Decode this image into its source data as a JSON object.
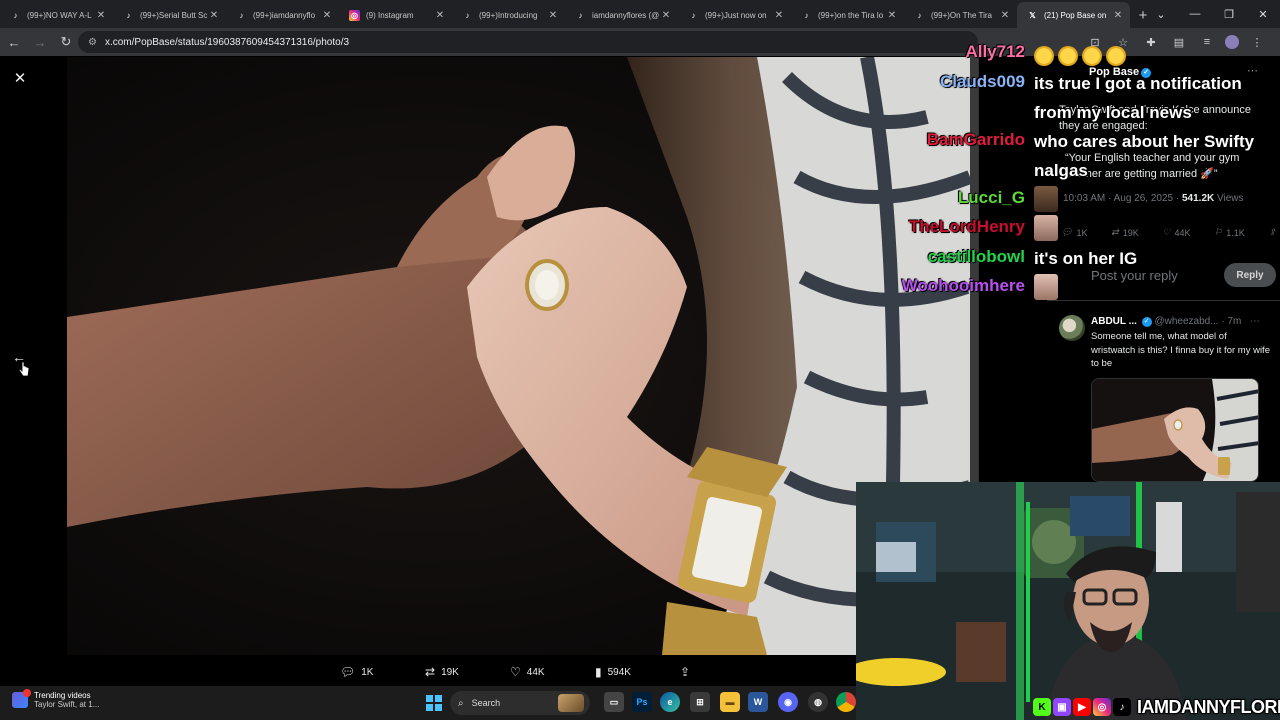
{
  "tabs": [
    {
      "title": "(99+)NO WAY A-L",
      "favicon": "tiktok-icon"
    },
    {
      "title": "(99+)Serial Butt Sc",
      "favicon": "tiktok-icon"
    },
    {
      "title": "(99+)iamdannyflo",
      "favicon": "tiktok-icon"
    },
    {
      "title": "(9) Instagram",
      "favicon": "instagram-icon"
    },
    {
      "title": "(99+)Introducing",
      "favicon": "tiktok-icon"
    },
    {
      "title": "iamdannyflores (@",
      "favicon": "tiktok-icon"
    },
    {
      "title": "(99+)Just now on",
      "favicon": "tiktok-icon"
    },
    {
      "title": "(99+)on the Tira lo",
      "favicon": "tiktok-icon"
    },
    {
      "title": "(99+)On The Tira",
      "favicon": "tiktok-icon"
    },
    {
      "title": "(21) Pop Base on",
      "favicon": "x-icon",
      "active": true
    }
  ],
  "address": {
    "url": "x.com/PopBase/status/1960387609454371316/photo/3"
  },
  "photo_actions": {
    "replies": "1K",
    "reposts": "19K",
    "likes": "44K",
    "views": "594K"
  },
  "tweet": {
    "author": "Pop Base",
    "text": "Taylor Swift and Travis Kelce announce they are engaged:",
    "quote": "“Your English teacher and your gym teacher are getting married 🚀”",
    "time": "10:03 AM · Aug 26, 2025",
    "views": "541.2K",
    "views_label": "Views",
    "stats": {
      "replies": "1K",
      "reposts": "19K",
      "likes": "44K",
      "bookmarks": "1.1K"
    },
    "reply_placeholder": "Post your reply",
    "reply_button": "Reply"
  },
  "comment": {
    "author": "ABDUL ...",
    "handle": "@wheezabd...",
    "time": "7m",
    "text": "Someone tell me, what model of wristwatch is this? I finna buy it for my wife to be"
  },
  "chat": [
    {
      "user": "Ally712",
      "color": "#ff6fa5",
      "message": "",
      "emotes": 4
    },
    {
      "user": "Clauds009",
      "color": "#8ab4f8",
      "message": "its true I got a notification from my local news"
    },
    {
      "user": "BamGarrido",
      "color": "#e01e3c",
      "message": "who cares about her Swifty nalgas"
    },
    {
      "user": "Lucci_G",
      "color": "#5ed83b",
      "message": ""
    },
    {
      "user": "TheLordHenry",
      "color": "#c8102e",
      "message": ""
    },
    {
      "user": "castillobowl",
      "color": "#22d34a",
      "message": "it's on her IG"
    },
    {
      "user": "Woohooimhere",
      "color": "#b84ff0",
      "message": ""
    }
  ],
  "stream": {
    "handle": "IAMDANNYFLORES"
  },
  "taskbar": {
    "trend_title": "Trending videos",
    "trend_sub": "Taylor Swift, at 1...",
    "search_label": "Search"
  },
  "colors": {
    "accent": "#1d9bf0",
    "background": "#000000"
  }
}
